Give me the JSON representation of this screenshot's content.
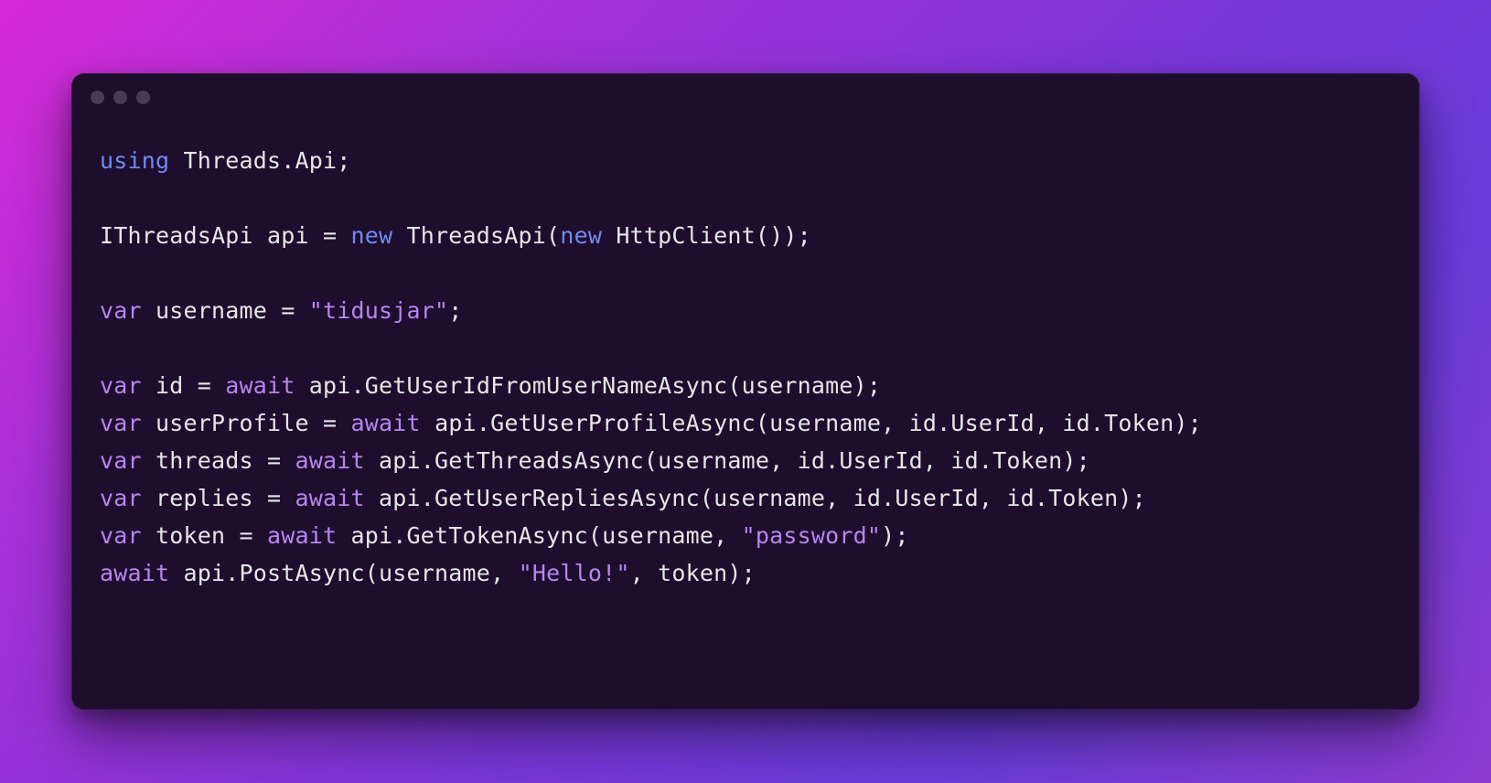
{
  "colors": {
    "window_bg": "#1f0d2e",
    "keyword_blue": "#6f8af0",
    "keyword_purple": "#b586ef",
    "string_purple": "#b586ef",
    "text": "#e6e6e6"
  },
  "code": {
    "l1": {
      "kw": "using",
      "rest": " Threads.Api;"
    },
    "l2": "",
    "l3": {
      "a": "IThreadsApi api = ",
      "kw1": "new",
      "b": " ThreadsApi(",
      "kw2": "new",
      "c": " HttpClient());"
    },
    "l4": "",
    "l5": {
      "kw": "var",
      "a": " username = ",
      "str": "\"tidusjar\"",
      "b": ";"
    },
    "l6": "",
    "l7": {
      "kw": "var",
      "a": " id = ",
      "aw": "await",
      "b": " api.GetUserIdFromUserNameAsync(username);"
    },
    "l8": {
      "kw": "var",
      "a": " userProfile = ",
      "aw": "await",
      "b": " api.GetUserProfileAsync(username, id.UserId, id.Token);"
    },
    "l9": {
      "kw": "var",
      "a": " threads = ",
      "aw": "await",
      "b": " api.GetThreadsAsync(username, id.UserId, id.Token);"
    },
    "l10": {
      "kw": "var",
      "a": " replies = ",
      "aw": "await",
      "b": " api.GetUserRepliesAsync(username, id.UserId, id.Token);"
    },
    "l11": {
      "kw": "var",
      "a": " token = ",
      "aw": "await",
      "b": " api.GetTokenAsync(username, ",
      "str": "\"password\"",
      "c": ");"
    },
    "l12": {
      "aw": "await",
      "a": " api.PostAsync(username, ",
      "str": "\"Hello!\"",
      "b": ", token);"
    }
  }
}
